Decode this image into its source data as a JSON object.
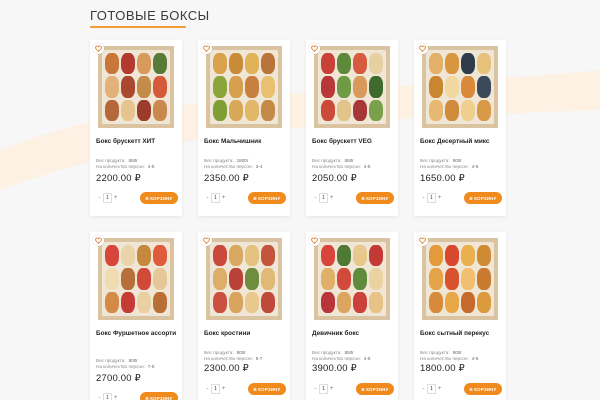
{
  "section": {
    "title": "ГОТОВЫЕ БОКСЫ"
  },
  "labels": {
    "weight": "Вес продукта:",
    "persons": "На количество персон:",
    "add_to_cart": "В КОРЗИНУ",
    "minus": "-",
    "plus": "+"
  },
  "colors": {
    "accent": "#f08a1c"
  },
  "products": [
    {
      "name": "Бокс брускетт ХИТ",
      "weight": "650г",
      "persons": "4-5",
      "price": "2200.00 ₽",
      "qty": "1"
    },
    {
      "name": "Бокс Мальчишник",
      "weight": "1800г",
      "persons": "3-4",
      "price": "2350.00 ₽",
      "qty": "1"
    },
    {
      "name": "Бокс брускетт VEG",
      "weight": "650г",
      "persons": "4-5",
      "price": "2050.00 ₽",
      "qty": "1"
    },
    {
      "name": "Бокс Десертный микс",
      "weight": "900г",
      "persons": "4-6",
      "price": "1650.00 ₽",
      "qty": "1"
    },
    {
      "name": "Бокс Фуршетное ассорти",
      "weight": "800г",
      "persons": "7-8",
      "price": "2700.00 ₽",
      "qty": "1"
    },
    {
      "name": "Бокс кростини",
      "weight": "800г",
      "persons": "5-7",
      "price": "2300.00 ₽",
      "qty": "1"
    },
    {
      "name": "Девичник бокс",
      "weight": "850г",
      "persons": "4-6",
      "price": "3900.00 ₽",
      "qty": "1"
    },
    {
      "name": "Бокс сытный перекус",
      "weight": "900г",
      "persons": "4-6",
      "price": "1800.00 ₽",
      "qty": "1"
    }
  ]
}
